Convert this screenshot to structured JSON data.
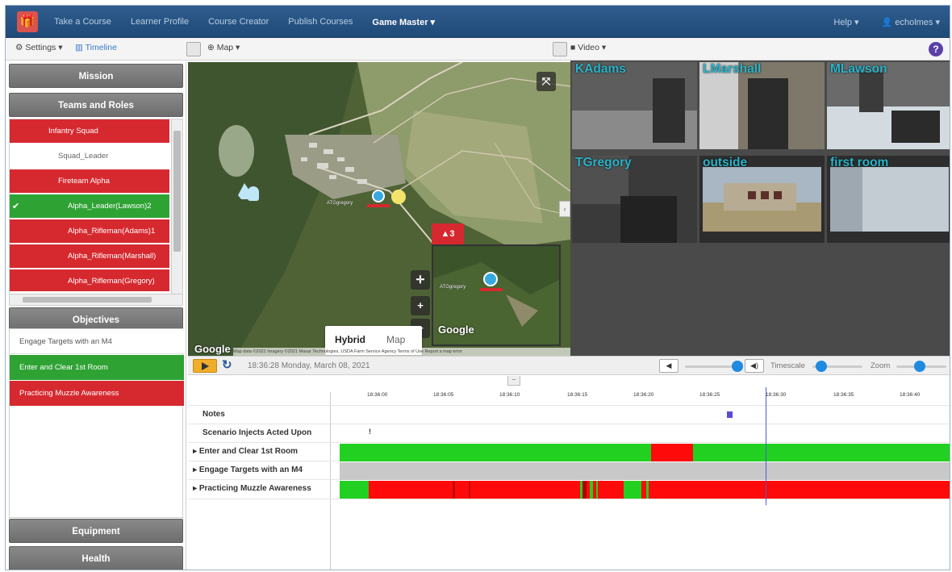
{
  "navbar": {
    "brand_icon": "gift-logo-icon",
    "items": [
      {
        "label": "Take a Course",
        "active": false
      },
      {
        "label": "Learner Profile",
        "active": false
      },
      {
        "label": "Course Creator",
        "active": false
      },
      {
        "label": "Publish Courses",
        "active": false
      },
      {
        "label": "Game Master ▾",
        "active": true
      }
    ],
    "help": "Help ▾",
    "user": "echolmes ▾"
  },
  "toolbar": {
    "settings": "Settings ▾",
    "timeline": "Timeline",
    "map": "Map ▾",
    "video": "Video ▾",
    "help_icon": "?"
  },
  "left_panel": {
    "mission": "Mission",
    "teams_and_roles": "Teams and Roles",
    "roles": [
      {
        "label": "Infantry Squad",
        "state": "red",
        "indent": 1
      },
      {
        "label": "Squad_Leader",
        "state": "white",
        "indent": 2
      },
      {
        "label": "Fireteam Alpha",
        "state": "red",
        "indent": 2
      },
      {
        "label": "Alpha_Leader(Lawson)2",
        "state": "green",
        "indent": 3,
        "checked": true
      },
      {
        "label": "Alpha_Rifleman(Adams)1",
        "state": "red",
        "indent": 3
      },
      {
        "label": "Alpha_Rifleman(Marshall)",
        "state": "red",
        "indent": 3
      },
      {
        "label": "Alpha_Rifleman(Gregory)",
        "state": "red",
        "indent": 3
      }
    ],
    "objectives_header": "Objectives",
    "objectives": [
      {
        "label": "Engage Targets with an M4",
        "state": "white"
      },
      {
        "label": "Enter and Clear 1st Room",
        "state": "green"
      },
      {
        "label": "Practicing Muzzle Awareness",
        "state": "red"
      }
    ],
    "equipment": "Equipment",
    "health": "Health"
  },
  "map": {
    "alert_count": "▲3",
    "map_type_options": [
      "Hybrid",
      "Map"
    ],
    "google": "Google",
    "inset_google": "Google",
    "attribution": "Map data ©2021 Imagery ©2021 Maxar Technologies, USDA Farm Service Agency   Terms of Use   Report a map error",
    "marker_label": "ATGgregory",
    "inset_marker_label": "ATGgregory"
  },
  "videos": [
    {
      "name": "KAdams"
    },
    {
      "name": "LMarshall"
    },
    {
      "name": "MLawson"
    },
    {
      "name": "TGregory"
    },
    {
      "name": "outside"
    },
    {
      "name": "first room"
    }
  ],
  "timeline_controls": {
    "datetime": "18:36:28 Monday, March 08, 2021",
    "timescale": "Timescale",
    "zoom": "Zoom"
  },
  "timeline": {
    "ticks": [
      "18:36:00",
      "18:36:05",
      "18:36:10",
      "18:36:15",
      "18:36:20",
      "18:36:25",
      "18:36:30",
      "18:36:35",
      "18:36:40"
    ],
    "rows": [
      {
        "label": "Notes",
        "expandable": false
      },
      {
        "label": "Scenario Injects Acted Upon",
        "expandable": false
      },
      {
        "label": "Enter and Clear 1st Room",
        "expandable": true
      },
      {
        "label": "Engage Targets with an M4",
        "expandable": true
      },
      {
        "label": "Practicing Muzzle Awareness",
        "expandable": true
      }
    ],
    "inject_marker": "!",
    "colors": {
      "pass": "#22d022",
      "fail": "#ff0a0a",
      "neutral": "#c8c8c8",
      "cursor": "#4a5bd6"
    }
  }
}
